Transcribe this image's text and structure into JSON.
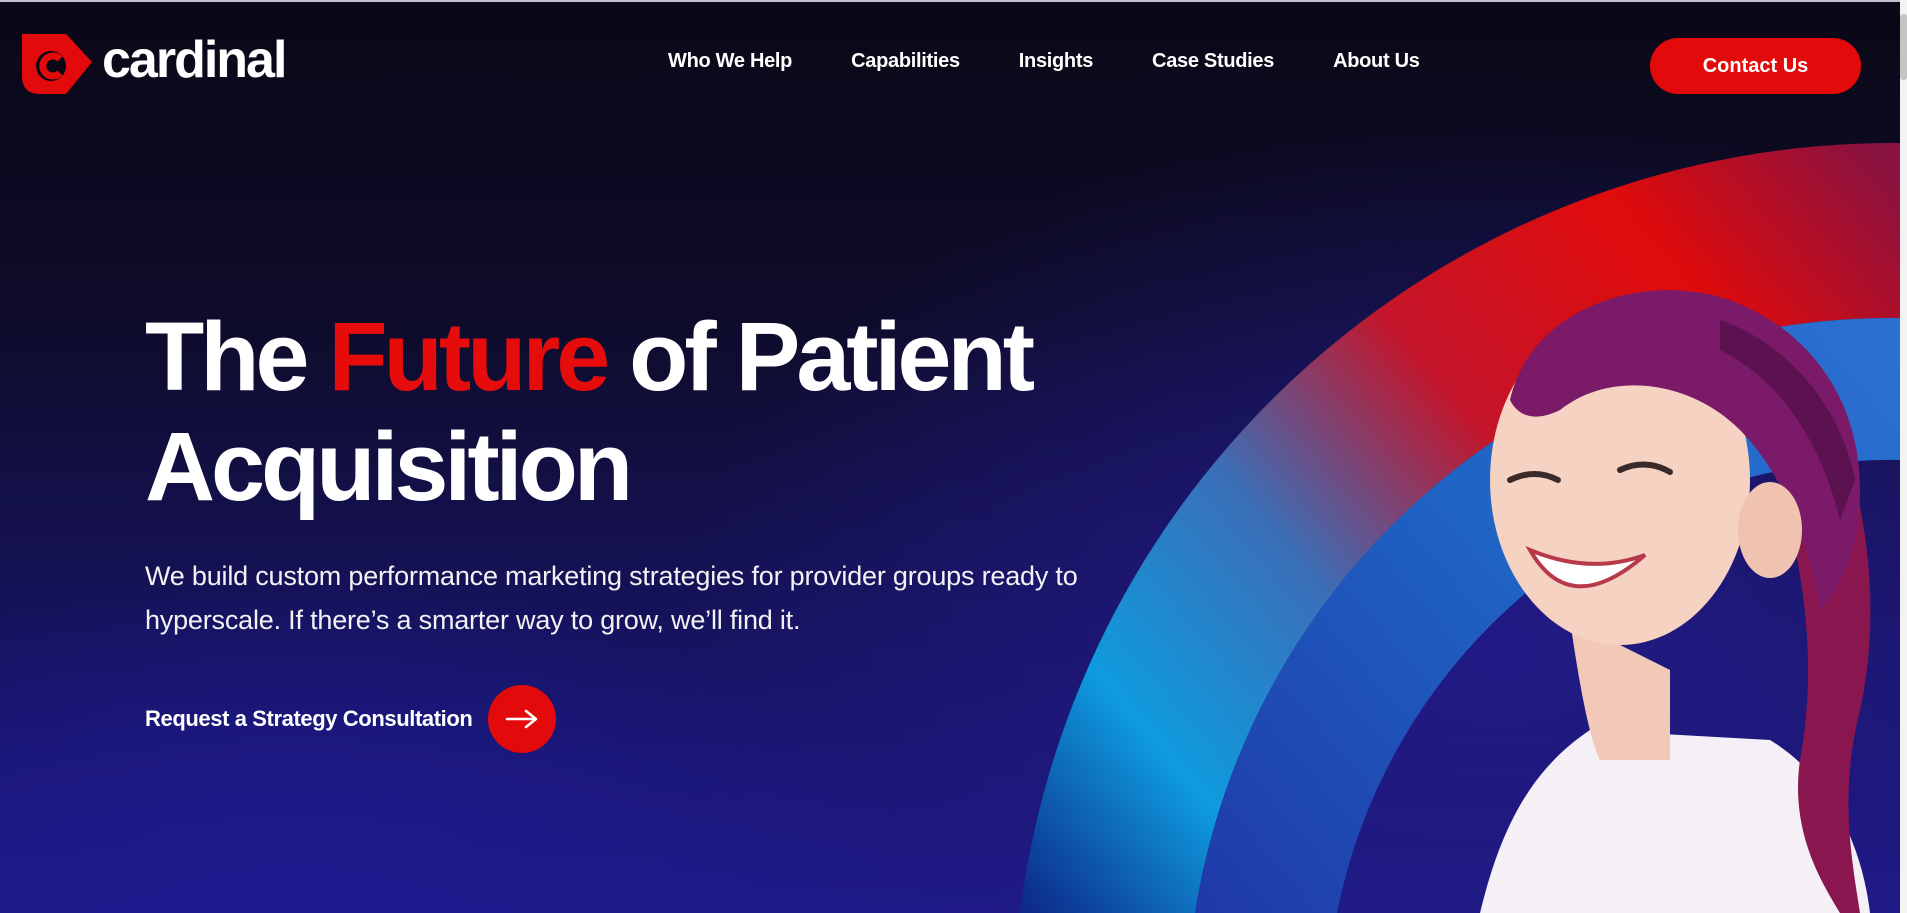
{
  "brand": {
    "name": "cardinal",
    "accent_color": "#e20a0a",
    "logo_icon": "cardinal-logo-icon"
  },
  "nav": {
    "items": [
      {
        "label": "Who We Help"
      },
      {
        "label": "Capabilities"
      },
      {
        "label": "Insights"
      },
      {
        "label": "Case Studies"
      },
      {
        "label": "About Us"
      }
    ],
    "contact_label": "Contact Us"
  },
  "hero": {
    "headline": {
      "part1": "The ",
      "accent": "Future",
      "part2": " of Patient",
      "line2": "Acquisition"
    },
    "subtext": "We build custom performance marketing strategies for provider groups ready to hyperscale. If there’s a smarter way to grow, we’ll find it.",
    "cta_label": "Request a Strategy Consultation",
    "cta_icon": "arrow-right-icon",
    "background_colors": [
      "#0a0816",
      "#1e1a88"
    ],
    "arc_colors": [
      "#e60c0c",
      "#0e9bde",
      "#1f5fbf"
    ]
  }
}
